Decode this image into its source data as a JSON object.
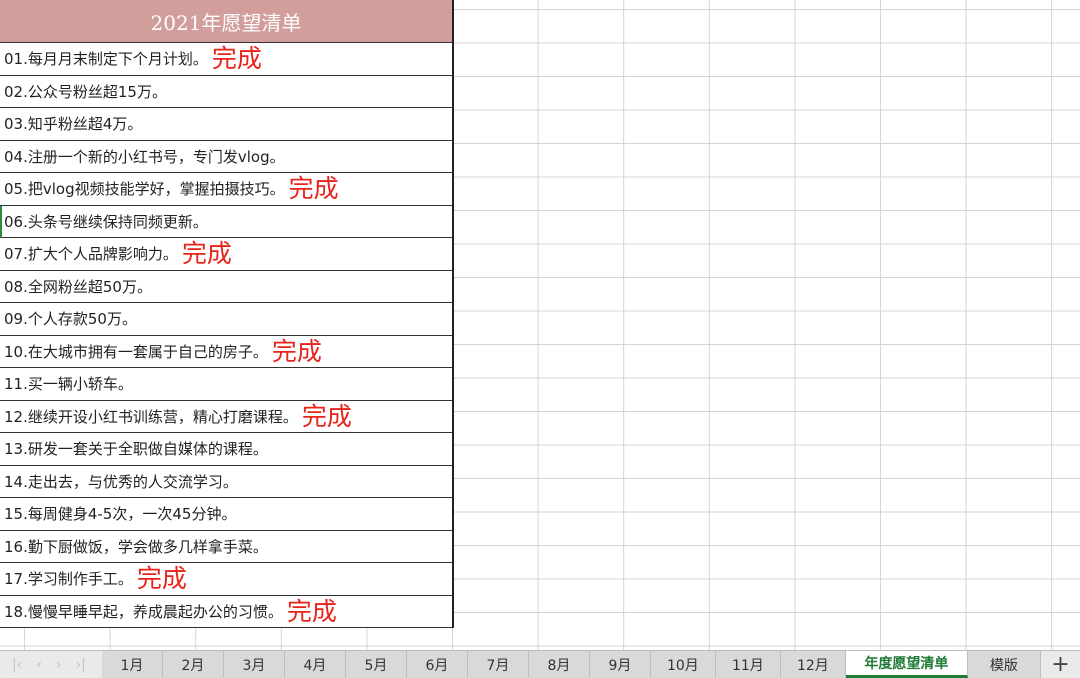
{
  "sheet": {
    "title": "2021年愿望清单",
    "done_label": "完成",
    "items": [
      {
        "text": "01.每月月末制定下个月计划。",
        "done": true
      },
      {
        "text": "02.公众号粉丝超15万。",
        "done": false
      },
      {
        "text": "03.知乎粉丝超4万。",
        "done": false
      },
      {
        "text": "04.注册一个新的小红书号，专门发vlog。",
        "done": false
      },
      {
        "text": "05.把vlog视频技能学好，掌握拍摄技巧。",
        "done": true
      },
      {
        "text": "06.头条号继续保持同频更新。",
        "done": false
      },
      {
        "text": "07.扩大个人品牌影响力。",
        "done": true
      },
      {
        "text": "08.全网粉丝超50万。",
        "done": false
      },
      {
        "text": "09.个人存款50万。",
        "done": false
      },
      {
        "text": "10.在大城市拥有一套属于自己的房子。",
        "done": true
      },
      {
        "text": "11.买一辆小轿车。",
        "done": false
      },
      {
        "text": "12.继续开设小红书训练营，精心打磨课程。",
        "done": true
      },
      {
        "text": "13.研发一套关于全职做自媒体的课程。",
        "done": false
      },
      {
        "text": "14.走出去，与优秀的人交流学习。",
        "done": false
      },
      {
        "text": "15.每周健身4-5次，一次45分钟。",
        "done": false
      },
      {
        "text": "16.勤下厨做饭，学会做多几样拿手菜。",
        "done": false
      },
      {
        "text": "17.学习制作手工。",
        "done": true
      },
      {
        "text": "18.慢慢早睡早起，养成晨起办公的习惯。",
        "done": true
      }
    ]
  },
  "tabs": [
    "1月",
    "2月",
    "3月",
    "4月",
    "5月",
    "6月",
    "7月",
    "8月",
    "9月",
    "10月",
    "11月",
    "12月",
    "年度愿望清单",
    "模版"
  ],
  "active_tab": "年度愿望清单",
  "add_tab_label": "+",
  "nav_icons": [
    "nav-first-icon",
    "nav-prev-icon",
    "nav-next-icon",
    "nav-last-icon"
  ],
  "colors": {
    "header_bg": "#d19e9c",
    "done": "#e8231a",
    "active_tab": "#1f7a36"
  }
}
